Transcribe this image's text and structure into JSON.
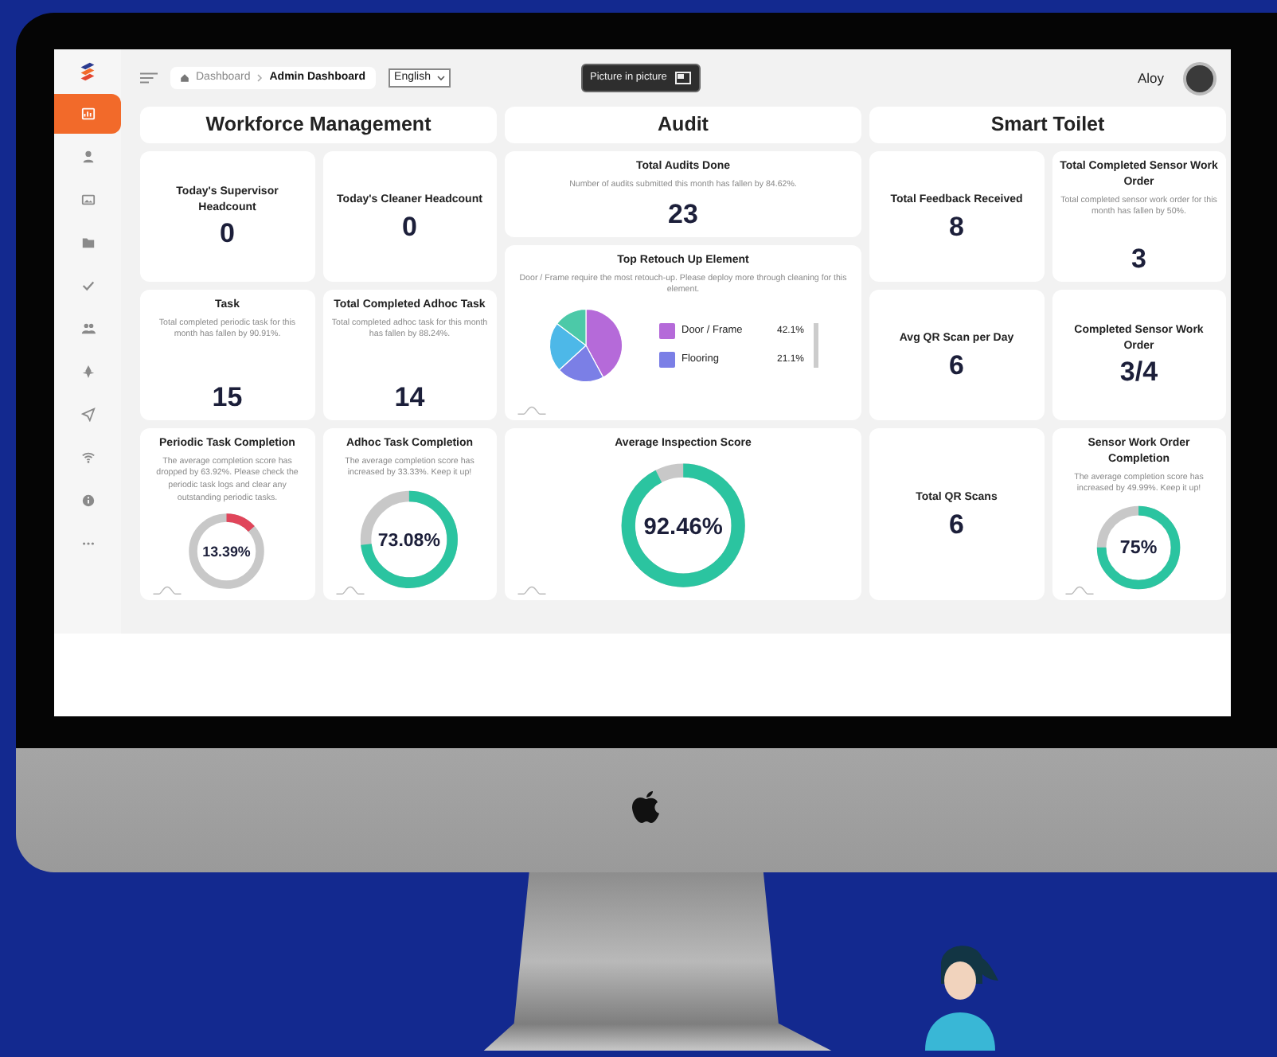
{
  "sidebar": {
    "items": [
      {
        "selected": true
      },
      {
        "selected": false
      },
      {
        "selected": false
      },
      {
        "selected": false
      },
      {
        "selected": false
      },
      {
        "selected": false
      },
      {
        "selected": false
      },
      {
        "selected": false
      },
      {
        "selected": false
      },
      {
        "selected": false
      },
      {
        "selected": false
      }
    ]
  },
  "topbar": {
    "breadcrumb": [
      {
        "label": "Dashboard",
        "current": false
      },
      {
        "label": "Admin Dashboard",
        "current": true
      }
    ],
    "language": "English",
    "pip_button": "Picture in picture",
    "user": "Aloy"
  },
  "sections": [
    {
      "title": "Workforce Management",
      "cards": [
        {
          "kind": "stat",
          "title": "Today's Supervisor Headcount",
          "value": "0"
        },
        {
          "kind": "stat",
          "title": "Today's Cleaner Headcount",
          "value": "0"
        },
        {
          "kind": "stat",
          "title": "Task",
          "description": "Total completed periodic task for this month has fallen by 90.91%.",
          "value": "15"
        },
        {
          "kind": "stat",
          "title": "Total Completed Adhoc Task",
          "description": "Total completed adhoc task for this month has fallen by 88.24%.",
          "value": "14"
        },
        {
          "kind": "gauge",
          "title": "Periodic Task Completion",
          "description": "The average completion score has dropped by 63.92%. Please check the periodic task logs and clear any outstanding periodic tasks.",
          "reading": "13.39%",
          "level": 0.1339,
          "color": "#e0455a"
        },
        {
          "kind": "gauge",
          "title": "Adhoc Task Completion",
          "description": "The average completion score has increased by 33.33%. Keep it up!",
          "reading": "73.08%",
          "level": 0.7308,
          "color": "#2bc4a0"
        }
      ]
    },
    {
      "title": "Audit",
      "cards": [
        {
          "kind": "stat",
          "title": "Total Audits Done",
          "description": "Number of audits submitted this month has fallen by 84.62%.",
          "value": "23"
        },
        {
          "kind": "pie",
          "title": "Top Retouch Up Element",
          "description": "Door / Frame require the most retouch-up. Please deploy more through cleaning for this element.",
          "legend": [
            {
              "label": "Door / Frame",
              "value": "42.1%",
              "color": "#b56ad9"
            },
            {
              "label": "Flooring",
              "value": "21.1%",
              "color": "#7b7fe6"
            }
          ]
        },
        {
          "kind": "gauge",
          "title": "Average Inspection Score",
          "reading": "92.46%",
          "level": 0.9246,
          "color": "#2bc4a0"
        }
      ]
    },
    {
      "title": "Smart Toilet",
      "cards": [
        {
          "kind": "stat",
          "title": "Total Feedback Received",
          "value": "8"
        },
        {
          "kind": "stat",
          "title": "Total Completed Sensor Work Order",
          "description": "Total completed sensor work order for this month has fallen by 50%.",
          "value": "3"
        },
        {
          "kind": "stat",
          "title": "Avg QR Scan per Day",
          "value": "6"
        },
        {
          "kind": "stat",
          "title": "Completed Sensor Work Order",
          "value": "3/4"
        },
        {
          "kind": "stat",
          "title": "Total QR Scans",
          "value": "6"
        },
        {
          "kind": "gauge",
          "title": "Sensor Work Order Completion",
          "description": "The average completion score has increased by 49.99%. Keep it up!",
          "reading": "75%",
          "level": 0.75,
          "color": "#2bc4a0"
        }
      ]
    }
  ]
}
